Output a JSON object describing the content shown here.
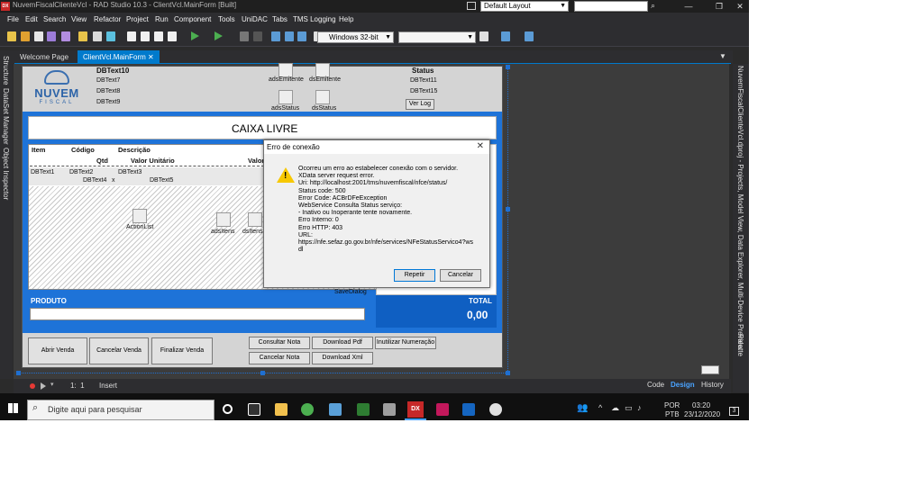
{
  "window": {
    "title": "NuvemFiscalClienteVcl - RAD Studio 10.3 - ClientVcl.MainForm [Built]",
    "layout": "Default Layout",
    "logo_text": "DX"
  },
  "menu": [
    "File",
    "Edit",
    "Search",
    "View",
    "Refactor",
    "Project",
    "Run",
    "Component",
    "Tools",
    "UniDAC",
    "Tabs",
    "TMS Logging",
    "Help"
  ],
  "toolbar": {
    "platform": "Windows 32-bit",
    "config": ""
  },
  "tabs": [
    {
      "label": "Welcome Page"
    },
    {
      "label": "ClientVcl.MainForm"
    }
  ],
  "left_panel": {
    "structure": "Structure",
    "dataset": "DataSet Manager",
    "object_inspector": "Object Inspector"
  },
  "right_panel": {
    "projects": "NuvemFiscalClienteVcl.dproj - Projects, Model View, Data Explorer, Multi-Device Preview",
    "palette": "Palette"
  },
  "form": {
    "header": {
      "db_title": "DBText10",
      "db7": "DBText7",
      "db8": "DBText8",
      "db9": "DBText9",
      "ads_emitente": "adsEmitente",
      "ds_emitente": "dsEmitente",
      "ads_status": "adsStatus",
      "ds_status": "dsStatus",
      "status_label": "Status",
      "db11": "DBText11",
      "db15": "DBText15",
      "ver_log": "Ver Log"
    },
    "caixa": "CAIXA LIVRE",
    "grid_headers": {
      "item": "Item",
      "codigo": "Código",
      "descricao": "Descrição",
      "qtd": "Qtd",
      "valor_unitario": "Valor Unitário",
      "valor": "Valor"
    },
    "grid_row": {
      "db1": "DBText1",
      "db2": "DBText2",
      "db3": "DBText3",
      "db4": "DBText4",
      "x": "x",
      "db5": "DBText5"
    },
    "components": {
      "action_list": "ActionList",
      "ads_itens": "adsItens",
      "ds_itens": "dsItens",
      "save_dialog": "SaveDialog"
    },
    "produto": "PRODUTO",
    "total_label": "TOTAL",
    "total_value": "0,00",
    "buttons": {
      "abrir_venda": "Abrir Venda",
      "cancelar_venda": "Cancelar Venda",
      "finalizar_venda": "Finalizar Venda",
      "consultar_nota": "Consultar Nota",
      "download_pdf": "Download Pdf",
      "inutilizar": "Inutilizar Numeração",
      "cancelar_nota": "Cancelar Nota",
      "download_xml": "Download Xml"
    }
  },
  "logo": {
    "nuvem": "NUVEM",
    "fiscal": "FISCAL"
  },
  "dialog": {
    "title": "Erro de conexão",
    "lines": [
      "Ocorreu um erro ao estabelecer conexão com o servidor.",
      "XData server request error.",
      "Uri: http://localhost:2001/tms/nuvemfiscal/nfce/status/",
      "Status code: 500",
      "Error Code: ACBrDFeException",
      "WebService Consulta Status serviço:",
      "- Inativo ou Inoperante tente novamente.",
      "Erro Interno: 0",
      "Erro HTTP: 403",
      "URL:",
      "https://nfe.sefaz.go.gov.br/nfe/services/NFeStatusServico4?ws",
      "dl"
    ],
    "retry": "Repetir",
    "cancel": "Cancelar"
  },
  "status": {
    "position": "1:  1",
    "mode": "Insert",
    "code_tab": "Code",
    "design_tab": "Design",
    "history_tab": "History"
  },
  "taskbar": {
    "search_placeholder": "Digite aqui para pesquisar",
    "lang1": "POR",
    "lang2": "PTB",
    "time": "03:20",
    "date": "23/12/2020",
    "badge": "3"
  },
  "colors": {
    "accent": "#007acc",
    "form_blue": "#1e73d8",
    "total_blue": "#1565c0",
    "warn": "#f7c800"
  }
}
